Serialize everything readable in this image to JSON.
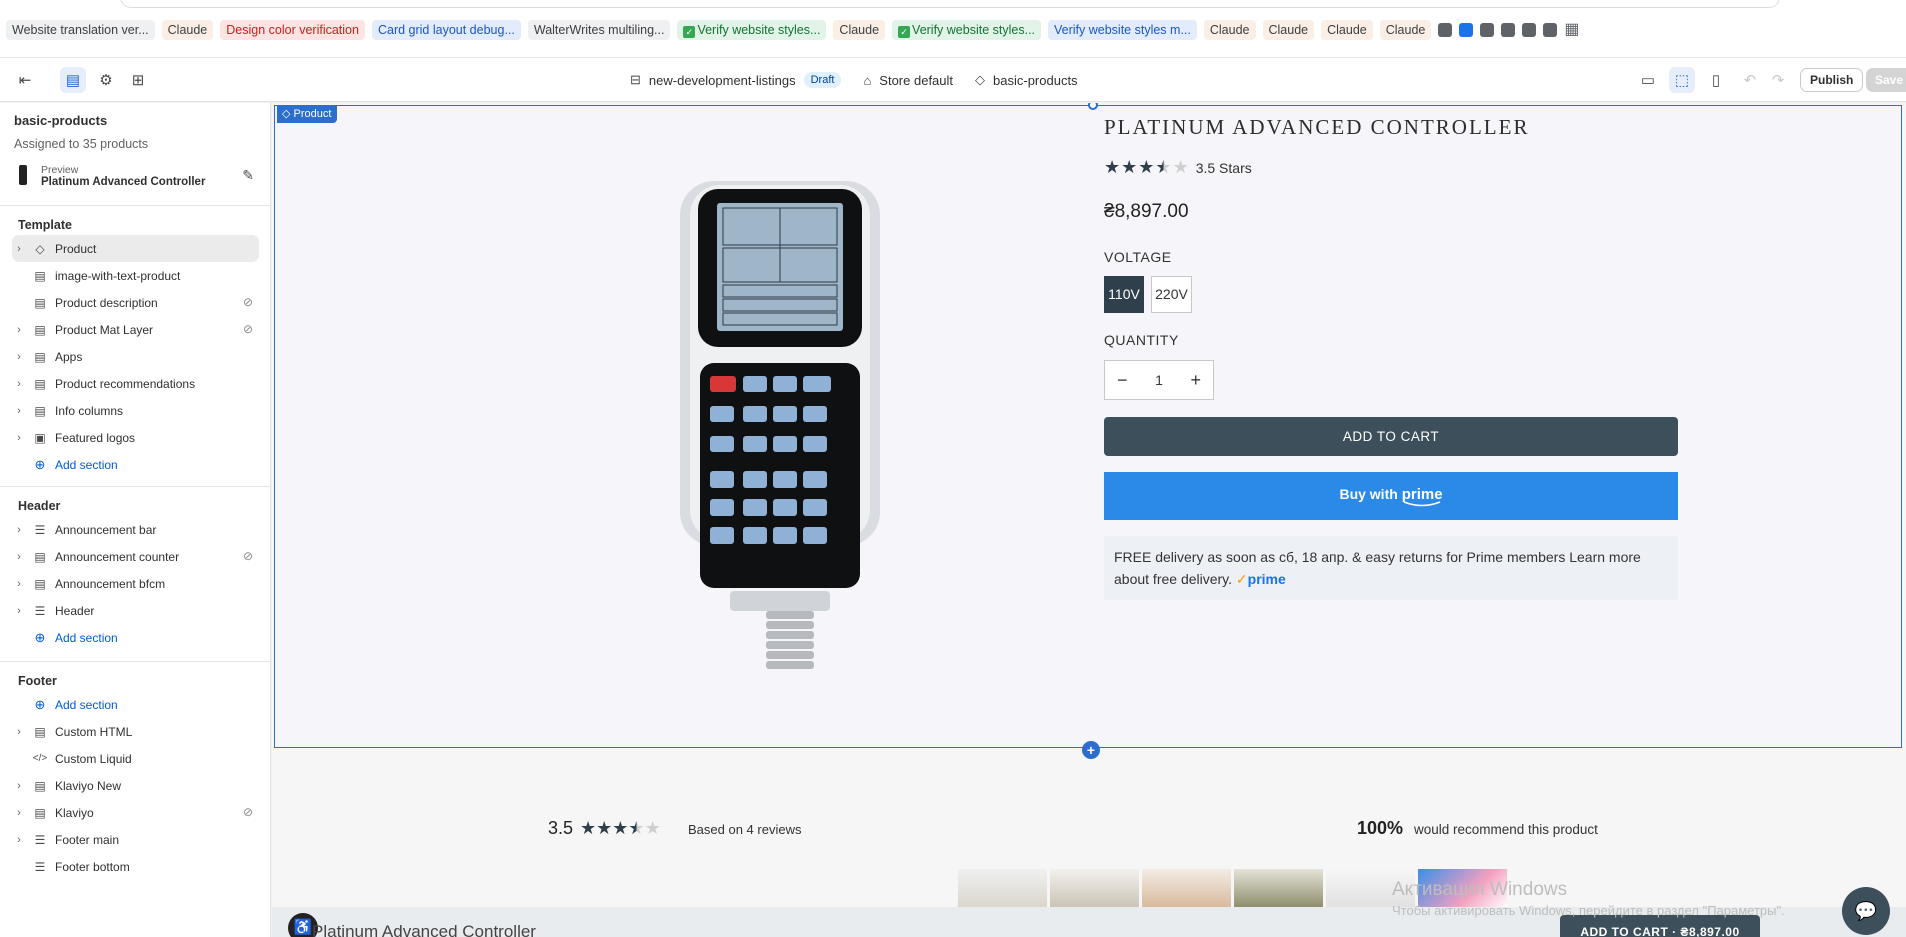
{
  "bookmarks": [
    {
      "label": "Website translation ver...",
      "style": "gray"
    },
    {
      "label": "Claude",
      "style": "peach"
    },
    {
      "label": "Design color verification",
      "style": "red"
    },
    {
      "label": "Card grid layout debug...",
      "style": "blue"
    },
    {
      "label": "WalterWrites multiling...",
      "style": "gray"
    },
    {
      "label": "Verify website styles...",
      "style": "green",
      "check": true
    },
    {
      "label": "Claude",
      "style": "peach"
    },
    {
      "label": "Verify website styles...",
      "style": "green",
      "check": true
    },
    {
      "label": "Verify website styles m...",
      "style": "blue"
    },
    {
      "label": "Claude",
      "style": "peach"
    },
    {
      "label": "Claude",
      "style": "peach"
    },
    {
      "label": "Claude",
      "style": "peach"
    },
    {
      "label": "Claude",
      "style": "peach"
    }
  ],
  "toolbar": {
    "template_name": "new-development-listings",
    "status_badge": "Draft",
    "store": "Store default",
    "template": "basic-products",
    "publish_label": "Publish",
    "save_label": "Save"
  },
  "sidebar": {
    "title": "basic-products",
    "subtitle": "Assigned to 35 products",
    "preview_label": "Preview",
    "preview_value": "Platinum Advanced Controller",
    "template_heading": "Template",
    "template_items": [
      {
        "label": "Product",
        "icon": "tag-icon",
        "caret": true,
        "selected": true
      },
      {
        "label": "image-with-text-product",
        "icon": "section-icon",
        "caret": false
      },
      {
        "label": "Product description",
        "icon": "section-icon",
        "caret": false,
        "hidden": true
      },
      {
        "label": "Product Mat Layer",
        "icon": "section-icon",
        "caret": true,
        "hidden": true
      },
      {
        "label": "Apps",
        "icon": "section-icon",
        "caret": true
      },
      {
        "label": "Product recommendations",
        "icon": "section-icon",
        "caret": true
      },
      {
        "label": "Info columns",
        "icon": "section-icon",
        "caret": true
      },
      {
        "label": "Featured logos",
        "icon": "image-icon",
        "caret": true
      }
    ],
    "add_section_label": "Add section",
    "header_heading": "Header",
    "header_items": [
      {
        "label": "Announcement bar",
        "icon": "layout-icon",
        "caret": true
      },
      {
        "label": "Announcement counter",
        "icon": "section-icon",
        "caret": true,
        "hidden": true
      },
      {
        "label": "Announcement bfcm",
        "icon": "section-icon",
        "caret": true
      },
      {
        "label": "Header",
        "icon": "layout-icon",
        "caret": true
      }
    ],
    "footer_heading": "Footer",
    "footer_items": [
      {
        "label": "Custom HTML",
        "icon": "section-icon",
        "caret": true
      },
      {
        "label": "Custom Liquid",
        "icon": "code-icon",
        "caret": false
      },
      {
        "label": "Klaviyo New",
        "icon": "section-icon",
        "caret": true
      },
      {
        "label": "Klaviyo",
        "icon": "section-icon",
        "caret": true,
        "hidden": true
      },
      {
        "label": "Footer main",
        "icon": "layout-icon",
        "caret": true
      },
      {
        "label": "Footer bottom",
        "icon": "layout-icon",
        "caret": false
      }
    ]
  },
  "preview": {
    "section_tag": "Product",
    "product_title": "PLATINUM ADVANCED CONTROLLER",
    "rating_value": 3.5,
    "rating_text": "3.5 Stars",
    "price": "₴8,897.00",
    "voltage_label": "VOLTAGE",
    "voltage_options": [
      "110V",
      "220V"
    ],
    "voltage_selected": "110V",
    "quantity_label": "QUANTITY",
    "quantity_value": "1",
    "add_to_cart": "ADD TO CART",
    "buy_with": "Buy with",
    "prime_word": "prime",
    "delivery_text": "FREE delivery as soon as сб, 18 апр. & easy returns for Prime members Learn more about free delivery.",
    "delivery_prime": "prime",
    "reviews_score": "3.5",
    "reviews_based": "Based on 4 reviews",
    "recommend_pct": "100%",
    "recommend_text": "would recommend this product",
    "sticky_title": "Platinum Advanced Controller",
    "sticky_button": "ADD TO CART · ₴8,897.00",
    "watermark_title": "Активация Windows",
    "watermark_sub": "Чтобы активировать Windows, перейдите в раздел \"Параметры\"."
  },
  "colors": {
    "accent": "#2c6ecb",
    "button_dark": "#3d4f5a",
    "prime_blue": "#2b8ae8"
  }
}
